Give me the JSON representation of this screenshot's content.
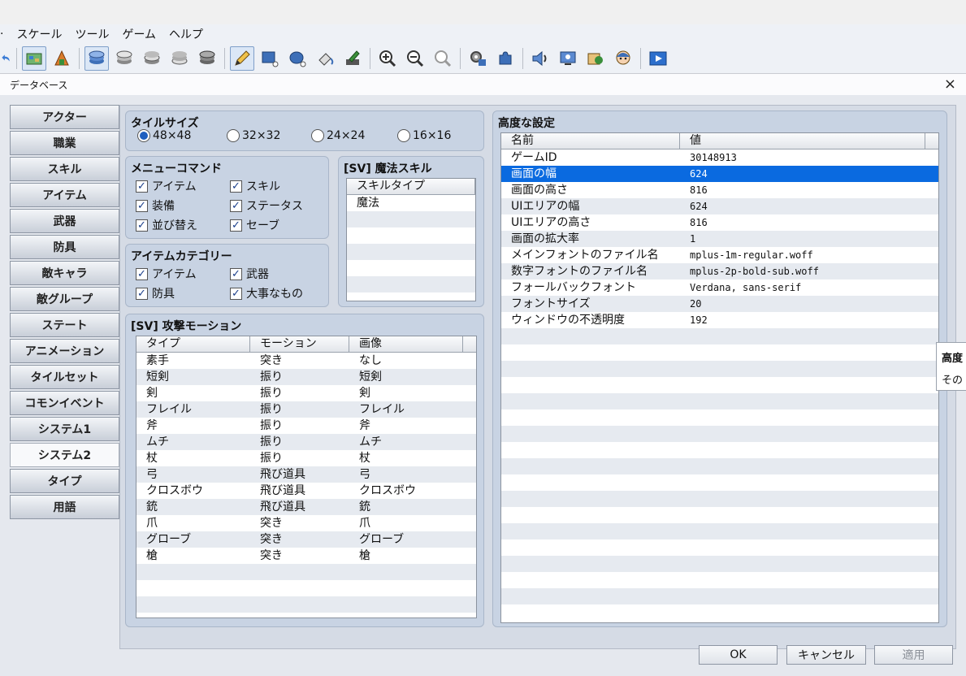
{
  "menubar": [
    "スケール",
    "ツール",
    "ゲーム",
    "ヘルプ"
  ],
  "dialog": {
    "title": "データベース",
    "close": "×"
  },
  "sidebar": {
    "items": [
      "アクター",
      "職業",
      "スキル",
      "アイテム",
      "武器",
      "防具",
      "敵キャラ",
      "敵グループ",
      "ステート",
      "アニメーション",
      "タイルセット",
      "コモンイベント",
      "システム1",
      "システム2",
      "タイプ",
      "用語"
    ],
    "active": "システム2"
  },
  "tile_size": {
    "title": "タイルサイズ",
    "options": [
      "48×48",
      "32×32",
      "24×24",
      "16×16"
    ],
    "selected": "48×48"
  },
  "menu_commands": {
    "title": "メニューコマンド",
    "items": [
      {
        "label": "アイテム",
        "checked": true
      },
      {
        "label": "スキル",
        "checked": true
      },
      {
        "label": "装備",
        "checked": true
      },
      {
        "label": "ステータス",
        "checked": true
      },
      {
        "label": "並び替え",
        "checked": true
      },
      {
        "label": "セーブ",
        "checked": true
      }
    ]
  },
  "item_categories": {
    "title": "アイテムカテゴリー",
    "items": [
      {
        "label": "アイテム",
        "checked": true
      },
      {
        "label": "武器",
        "checked": true
      },
      {
        "label": "防具",
        "checked": true
      },
      {
        "label": "大事なもの",
        "checked": true
      }
    ]
  },
  "magic_skills": {
    "title": "[SV] 魔法スキル",
    "header": "スキルタイプ",
    "rows": [
      "魔法"
    ]
  },
  "attack_motions": {
    "title": "[SV] 攻撃モーション",
    "headers": [
      "タイプ",
      "モーション",
      "画像"
    ],
    "rows": [
      [
        "素手",
        "突き",
        "なし"
      ],
      [
        "短剣",
        "振り",
        "短剣"
      ],
      [
        "剣",
        "振り",
        "剣"
      ],
      [
        "フレイル",
        "振り",
        "フレイル"
      ],
      [
        "斧",
        "振り",
        "斧"
      ],
      [
        "ムチ",
        "振り",
        "ムチ"
      ],
      [
        "杖",
        "振り",
        "杖"
      ],
      [
        "弓",
        "飛び道具",
        "弓"
      ],
      [
        "クロスボウ",
        "飛び道具",
        "クロスボウ"
      ],
      [
        "銃",
        "飛び道具",
        "銃"
      ],
      [
        "爪",
        "突き",
        "爪"
      ],
      [
        "グローブ",
        "突き",
        "グローブ"
      ],
      [
        "槍",
        "突き",
        "槍"
      ]
    ]
  },
  "advanced": {
    "title": "高度な設定",
    "headers": [
      "名前",
      "値"
    ],
    "rows": [
      [
        "ゲームID",
        "30148913"
      ],
      [
        "画面の幅",
        "624"
      ],
      [
        "画面の高さ",
        "816"
      ],
      [
        "UIエリアの幅",
        "624"
      ],
      [
        "UIエリアの高さ",
        "816"
      ],
      [
        "画面の拡大率",
        "1"
      ],
      [
        "メインフォントのファイル名",
        "mplus-1m-regular.woff"
      ],
      [
        "数字フォントのファイル名",
        "mplus-2p-bold-sub.woff"
      ],
      [
        "フォールバックフォント",
        "Verdana, sans-serif"
      ],
      [
        "フォントサイズ",
        "20"
      ],
      [
        "ウィンドウの不透明度",
        "192"
      ]
    ],
    "selected_row": 1
  },
  "tooltip": {
    "title": "高度",
    "body": "その"
  },
  "buttons": {
    "ok": "OK",
    "cancel": "キャンセル",
    "apply": "適用"
  },
  "toolbar_icons": [
    "undo-icon",
    "map-icon",
    "event-icon",
    "layer1-icon",
    "layer2-icon",
    "layer3-icon",
    "layer4-icon",
    "layer5-icon",
    "pencil-icon",
    "rectangle-icon",
    "ellipse-icon",
    "fill-icon",
    "shadow-pen-icon",
    "zoom-in-icon",
    "zoom-out-icon",
    "zoom-actual-icon",
    "database-icon",
    "plugin-icon",
    "sound-icon",
    "event-search-icon",
    "resource-icon",
    "character-generator-icon",
    "playtest-icon"
  ]
}
